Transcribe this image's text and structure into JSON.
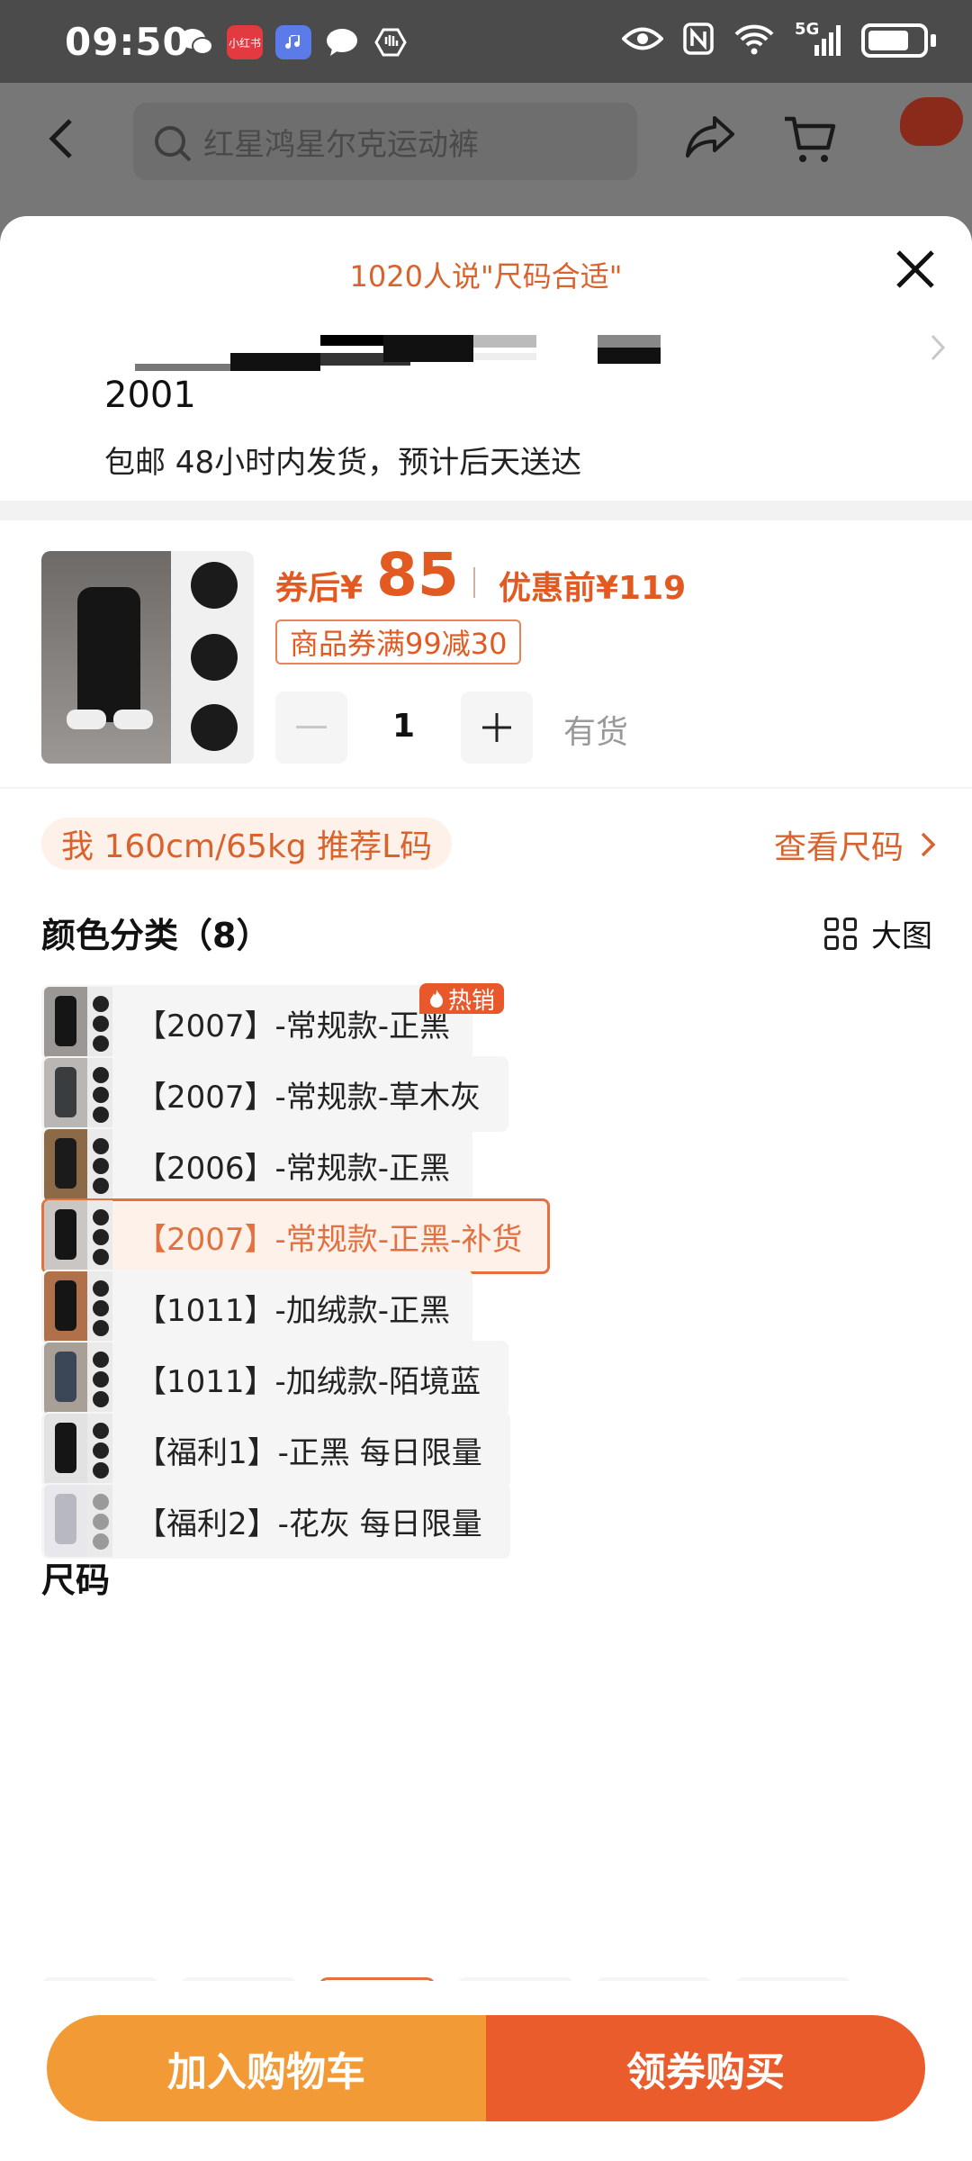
{
  "status_bar": {
    "time": "09:50",
    "network": "5G",
    "app_icons": [
      "wechat-icon",
      "xiaohongshu-icon",
      "music-icon",
      "message-icon",
      "shield-icon"
    ]
  },
  "app_bar": {
    "search_placeholder": "红星鸿星尔克运动裤"
  },
  "sheet": {
    "fit_banner": "1020人说\"尺码合适\"",
    "address_number": "2001",
    "shipping_text": "包邮 48小时内发货，预计后天送达"
  },
  "product": {
    "price_label": "券后¥",
    "price": "85",
    "original_price": "优惠前¥119",
    "coupon": "商品券满99减30",
    "quantity": "1",
    "stock": "有货"
  },
  "recommendation": {
    "text": "我 160cm/65kg 推荐L码",
    "view_size": "查看尺码"
  },
  "colors": {
    "title": "颜色分类（8）",
    "big_view": "大图",
    "hot_badge": "热销",
    "items": [
      {
        "label": "【2007】-常规款-正黑"
      },
      {
        "label": "【2007】-常规款-草木灰"
      },
      {
        "label": "【2006】-常规款-正黑"
      },
      {
        "label": "【2007】-常规款-正黑-补货"
      },
      {
        "label": "【1011】-加绒款-正黑"
      },
      {
        "label": "【1011】-加绒款-陌境蓝"
      },
      {
        "label": "【福利1】-正黑 每日限量"
      },
      {
        "label": "【福利2】-花灰 每日限量"
      }
    ]
  },
  "size": {
    "title": "尺码"
  },
  "bottom_bar": {
    "add_to_cart": "加入购物车",
    "buy_now": "领券购买"
  },
  "theme": {
    "accent": "#e25a22",
    "cart_button": "#f29a36",
    "buy_button": "#ea5c2c"
  }
}
